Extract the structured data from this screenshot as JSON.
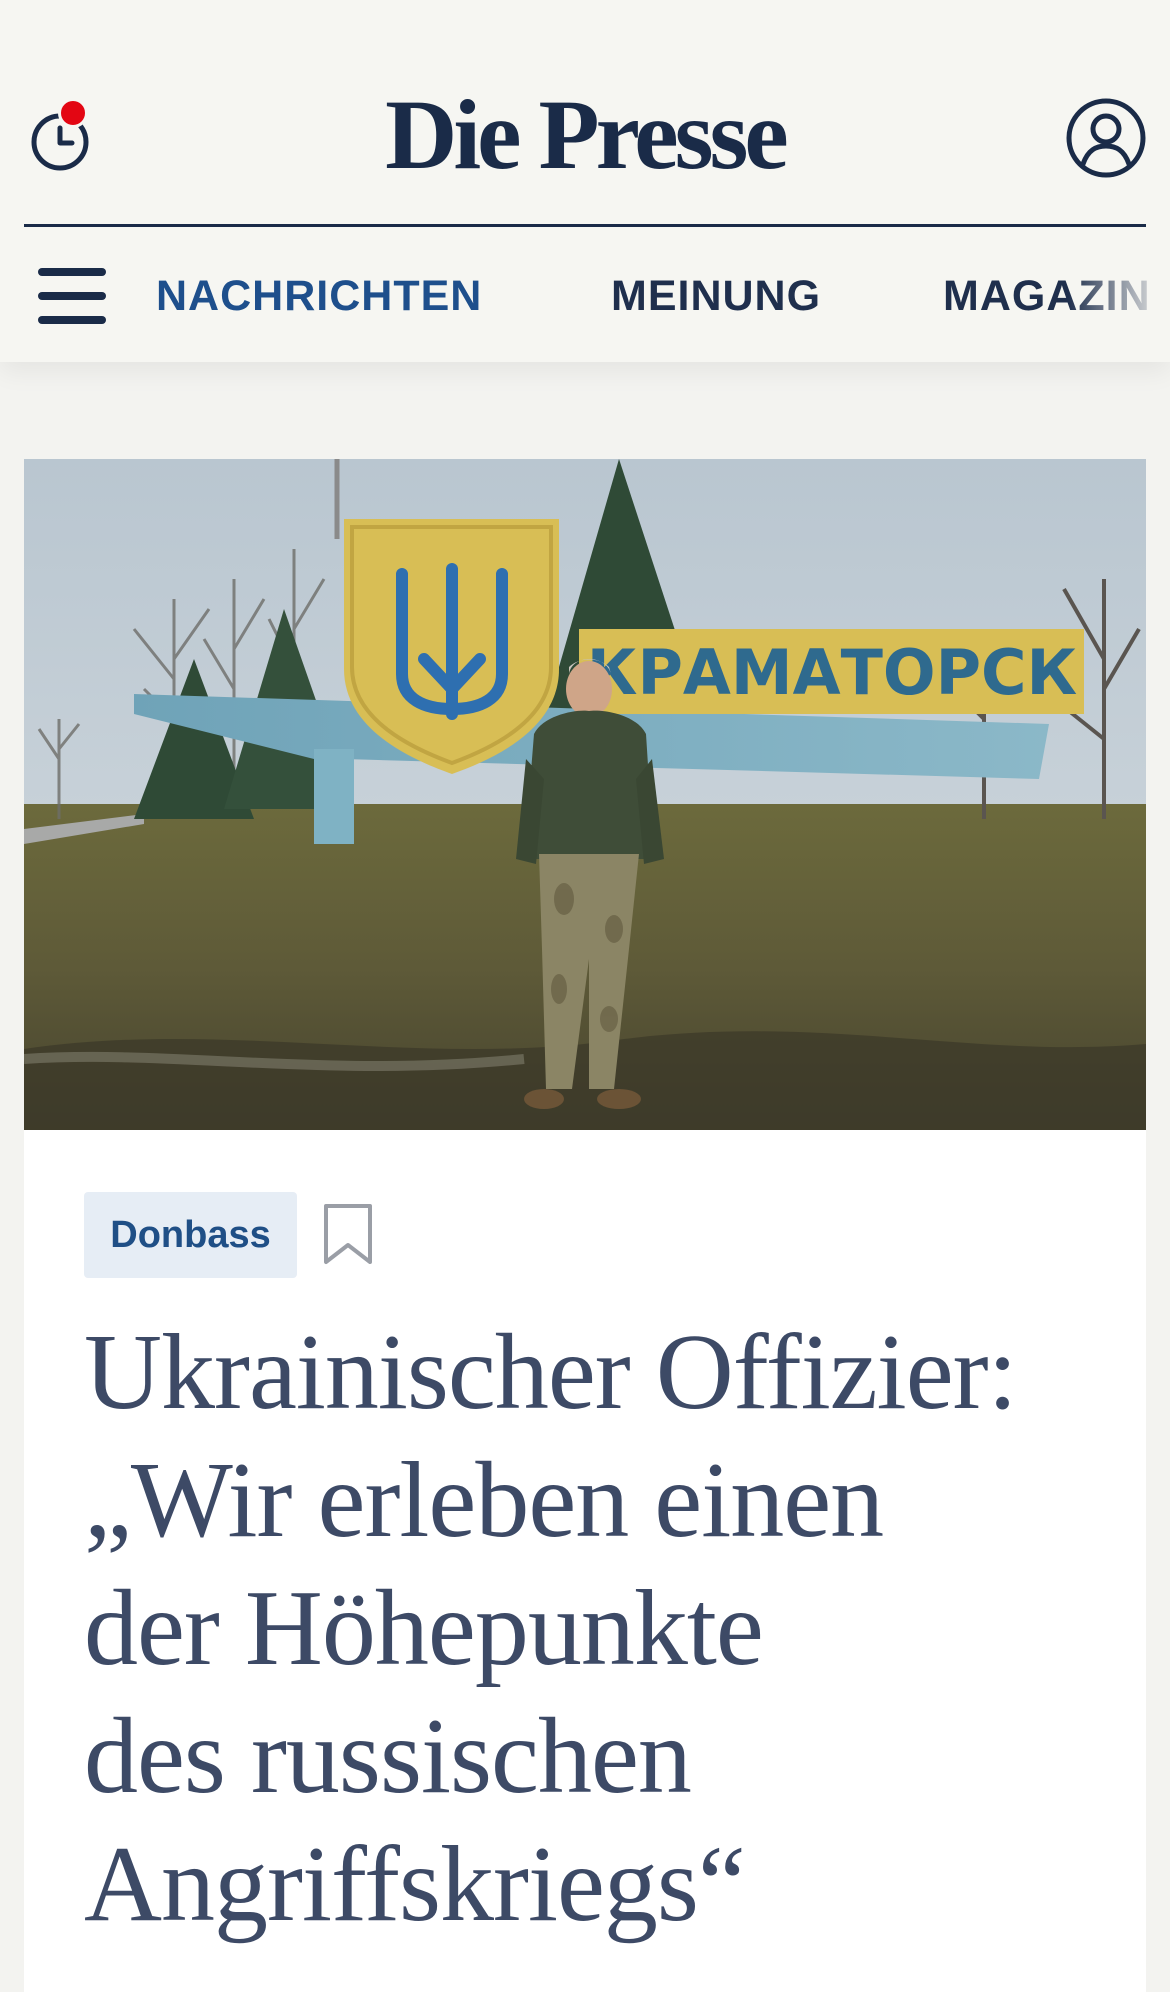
{
  "header": {
    "logo_text": "Die Presse",
    "history_icon": "clock-icon",
    "account_icon": "user-circle-icon",
    "menu_icon": "hamburger-menu-icon",
    "notification_color": "#e30613",
    "brand_color": "#1a2b48"
  },
  "nav": {
    "items": [
      {
        "label": "NACHRICHTEN",
        "active": true
      },
      {
        "label": "MEINUNG",
        "active": false
      },
      {
        "label": "MAGAZIN",
        "active": false
      }
    ],
    "active_color": "#1e4f8c"
  },
  "article": {
    "image_icon": "hero-photo",
    "image_sign_text": "КРАМАТОРСК",
    "tag": "Donbass",
    "bookmark_icon": "bookmark-icon",
    "headline": "Ukrainischer Offizier:\n„Wir erleben einen\nder Höhepunkte\ndes russischen\nAngriffskriegs“"
  }
}
